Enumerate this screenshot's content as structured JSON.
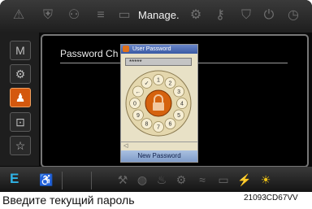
{
  "header": {
    "title": "Manage.",
    "icons": [
      "warning-icon",
      "lock-icon",
      "user-icon",
      "lines-icon",
      "card-icon",
      "gear-icon",
      "key-icon",
      "shield-icon",
      "power-icon",
      "clock-icon"
    ]
  },
  "sidebar": {
    "items": [
      {
        "label": "M",
        "icon": "m-icon",
        "active": false
      },
      {
        "label": "⚙",
        "icon": "gear-icon",
        "active": false
      },
      {
        "label": "♟",
        "icon": "person-icon",
        "active": true
      },
      {
        "label": "⊡",
        "icon": "display-icon",
        "active": false
      },
      {
        "label": "☆",
        "icon": "star-icon",
        "active": false
      }
    ]
  },
  "main": {
    "password_label": "Password Ch"
  },
  "dialog": {
    "title": "User Password",
    "masked_value": "*****",
    "back_symbol": "◁",
    "button_label": "New Password",
    "keys": [
      "1",
      "2",
      "3",
      "4",
      "5",
      "6",
      "7",
      "8",
      "9",
      "0",
      "←",
      "✓"
    ],
    "colors": {
      "ring": "#e4d7ad",
      "center": "#d5620e",
      "accent": "#d47a20"
    }
  },
  "footer": {
    "e_label": "E",
    "icons": [
      "seat-icon",
      "tool-icon",
      "oil-icon",
      "temp-icon",
      "gear-icon",
      "coolant-icon",
      "battery-icon",
      "engine-icon",
      "headlight-icon"
    ]
  },
  "caption": "Введите текущий пароль",
  "reference_code": "21093CD67VV"
}
